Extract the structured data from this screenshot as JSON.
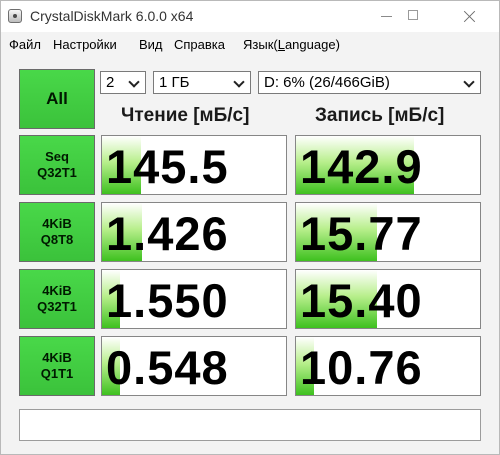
{
  "window": {
    "title": "CrystalDiskMark 6.0.0 x64"
  },
  "menu": {
    "file": "Файл",
    "settings": "Настройки",
    "view": "Вид",
    "help": "Справка",
    "language_prefix": "Язык(",
    "language_underlined": "L",
    "language_suffix": "anguage)"
  },
  "controls": {
    "all_label": "All",
    "count": "2",
    "size": "1 ГБ",
    "drive": "D: 6% (26/466GiB)"
  },
  "headers": {
    "read": "Чтение [мБ/с]",
    "write": "Запись [мБ/с]"
  },
  "rows": [
    {
      "line1": "Seq",
      "line2": "Q32T1",
      "read": "145.5",
      "write": "142.9",
      "read_fill": 0.21,
      "write_fill": 0.64
    },
    {
      "line1": "4KiB",
      "line2": "Q8T8",
      "read": "1.426",
      "write": "15.77",
      "read_fill": 0.22,
      "write_fill": 0.44
    },
    {
      "line1": "4KiB",
      "line2": "Q32T1",
      "read": "1.550",
      "write": "15.40",
      "read_fill": 0.1,
      "write_fill": 0.44
    },
    {
      "line1": "4KiB",
      "line2": "Q1T1",
      "read": "0.548",
      "write": "10.76",
      "read_fill": 0.1,
      "write_fill": 0.1
    }
  ],
  "status": {
    "text": ""
  },
  "colors": {
    "button_green": "#41cc41",
    "bar_green": "#3ec11f"
  }
}
